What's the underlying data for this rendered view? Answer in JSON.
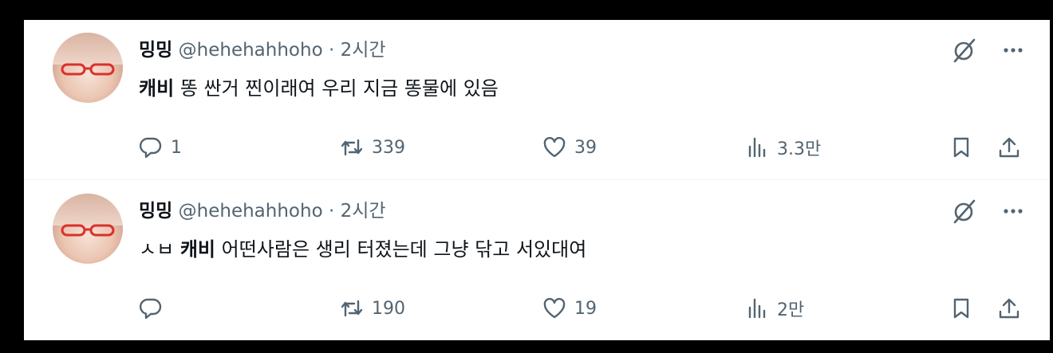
{
  "tweets": [
    {
      "display_name": "밍밍",
      "handle": "@hehehahhoho",
      "separator": "·",
      "time": "2시간",
      "prefix": "",
      "mention": "캐비",
      "text": "똥 싼거 찐이래여 우리 지금 똥물에 있음",
      "reply_count": "1",
      "retweet_count": "339",
      "like_count": "39",
      "view_count": "3.3만"
    },
    {
      "display_name": "밍밍",
      "handle": "@hehehahhoho",
      "separator": "·",
      "time": "2시간",
      "prefix": "ㅅㅂ",
      "mention": "캐비",
      "text": "어떤사람은 생리 터졌는데 그냥 닦고 서있대여",
      "reply_count": "",
      "retweet_count": "190",
      "like_count": "19",
      "view_count": "2만"
    }
  ],
  "icons": {
    "grok": "grok-icon",
    "more": "more-icon",
    "reply": "reply-icon",
    "retweet": "retweet-icon",
    "like": "heart-icon",
    "views": "views-icon",
    "bookmark": "bookmark-icon",
    "share": "share-icon"
  },
  "colors": {
    "text_primary": "#0f1419",
    "text_secondary": "#536471",
    "background": "#ffffff",
    "frame": "#000000"
  }
}
